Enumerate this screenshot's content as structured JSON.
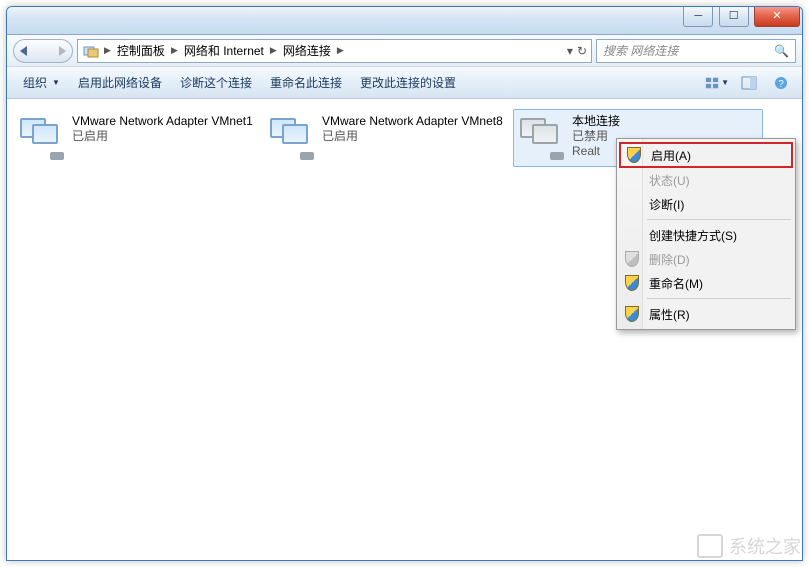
{
  "titlebar": {
    "min_label": "─",
    "max_label": "☐",
    "close_label": "✕"
  },
  "address": {
    "crumbs": [
      "控制面板",
      "网络和 Internet",
      "网络连接"
    ],
    "refresh_label": "↻",
    "dropdown_label": "▾"
  },
  "search": {
    "placeholder": "搜索 网络连接"
  },
  "toolbar": {
    "organize": "组织",
    "disable": "启用此网络设备",
    "diagnose": "诊断这个连接",
    "rename": "重命名此连接",
    "change": "更改此连接的设置"
  },
  "connections": [
    {
      "name": "VMware Network Adapter VMnet1",
      "status": "已启用",
      "disabled": false,
      "selected": false
    },
    {
      "name": "VMware Network Adapter VMnet8",
      "status": "已启用",
      "disabled": false,
      "selected": false
    },
    {
      "name": "本地连接",
      "status": "已禁用",
      "device_prefix": "Realt",
      "disabled": true,
      "selected": true
    }
  ],
  "context_menu": {
    "enable": "启用(A)",
    "status": "状态(U)",
    "diagnose": "诊断(I)",
    "shortcut": "创建快捷方式(S)",
    "delete": "删除(D)",
    "rename": "重命名(M)",
    "properties": "属性(R)"
  },
  "watermark": "系统之家"
}
